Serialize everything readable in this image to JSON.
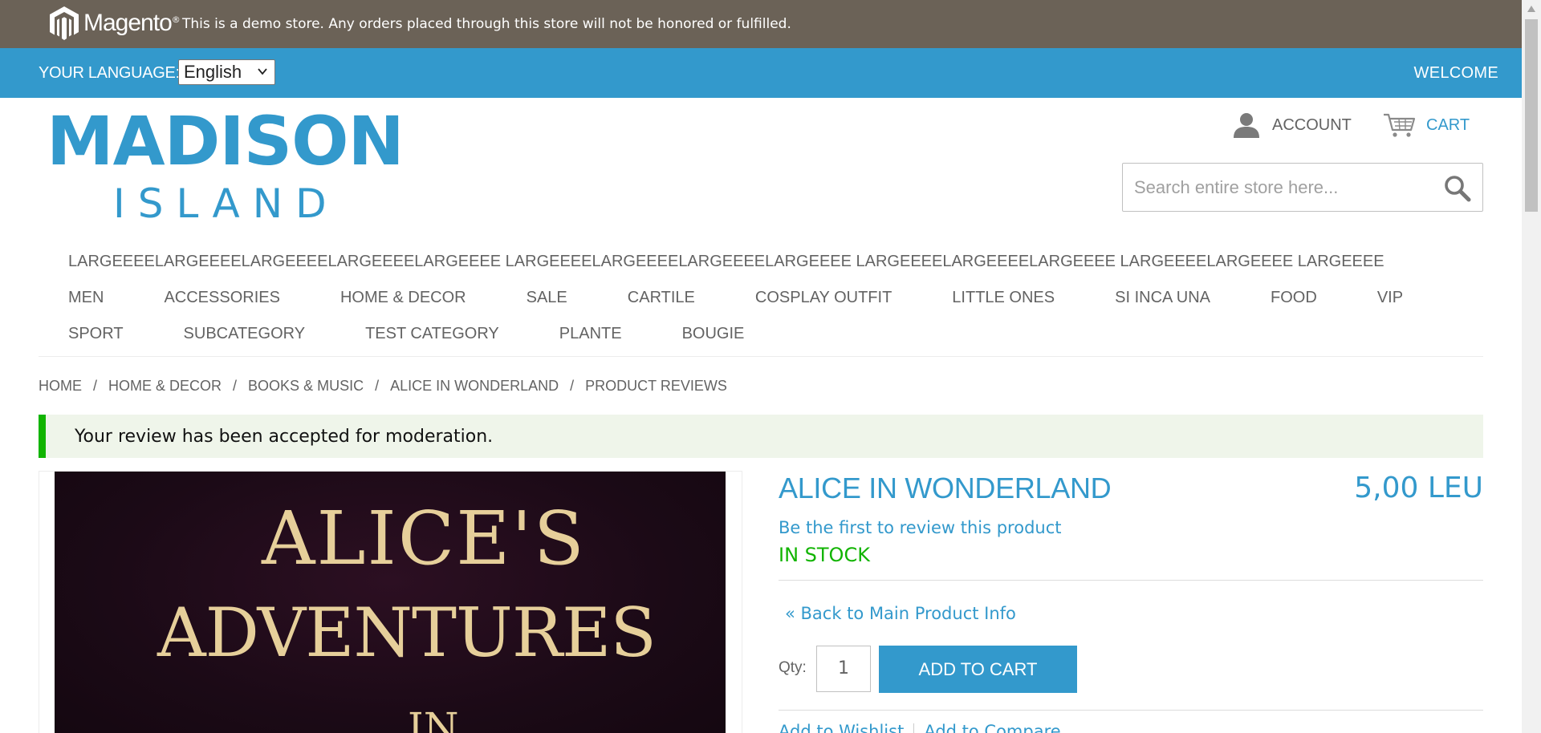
{
  "demo_notice": {
    "brand": "Magento",
    "text": "This is a demo store. Any orders placed through this store will not be honored or fulfilled."
  },
  "language_bar": {
    "label": "YOUR LANGUAGE:",
    "selected": "English",
    "welcome": "WELCOME"
  },
  "logo": {
    "line1": "MADISON",
    "line2": "ISLAND"
  },
  "header": {
    "account": "ACCOUNT",
    "cart": "CART",
    "search_placeholder": "Search entire store here..."
  },
  "nav": {
    "row1": [
      "LARGEEEELARGEEEELARGEEEELARGEEEELARGEEEE LARGEEEELARGEEEELARGEEEELARGEEEE LARGEEEELARGEEEELARGEEEE LARGEEEELARGEEEE LARGEEEE"
    ],
    "row2": [
      "MEN",
      "ACCESSORIES",
      "HOME & DECOR",
      "SALE",
      "CARTILE",
      "COSPLAY OUTFIT",
      "LITTLE ONES",
      "SI INCA UNA",
      "FOOD",
      "VIP"
    ],
    "row3": [
      "SPORT",
      "SUBCATEGORY",
      "TEST CATEGORY",
      "PLANTE",
      "BOUGIE"
    ]
  },
  "breadcrumb": [
    "HOME",
    "HOME & DECOR",
    "BOOKS & MUSIC",
    "ALICE IN WONDERLAND",
    "PRODUCT REVIEWS"
  ],
  "breadcrumb_separator": "/",
  "message": "Your review has been accepted for moderation.",
  "product": {
    "image_text": [
      "ALICE'S",
      "ADVENTURES",
      "IN"
    ],
    "name": "ALICE IN WONDERLAND",
    "price": "5,00 LEU",
    "review_link": "Be the first to review this product",
    "stock": "IN STOCK",
    "back_link": "« Back to Main Product Info",
    "qty_label": "Qty:",
    "qty_value": "1",
    "add_to_cart": "ADD TO CART",
    "wishlist_link": "Add to Wishlist",
    "compare_link": "Add to Compare"
  },
  "colors": {
    "demo_bar": "#6b6257",
    "accent": "#3399cc",
    "success": "#11b400",
    "message_bg": "#eff5ea"
  },
  "icons": [
    "magento-logo-icon",
    "chevron-down-icon",
    "user-icon",
    "cart-icon",
    "search-icon"
  ]
}
